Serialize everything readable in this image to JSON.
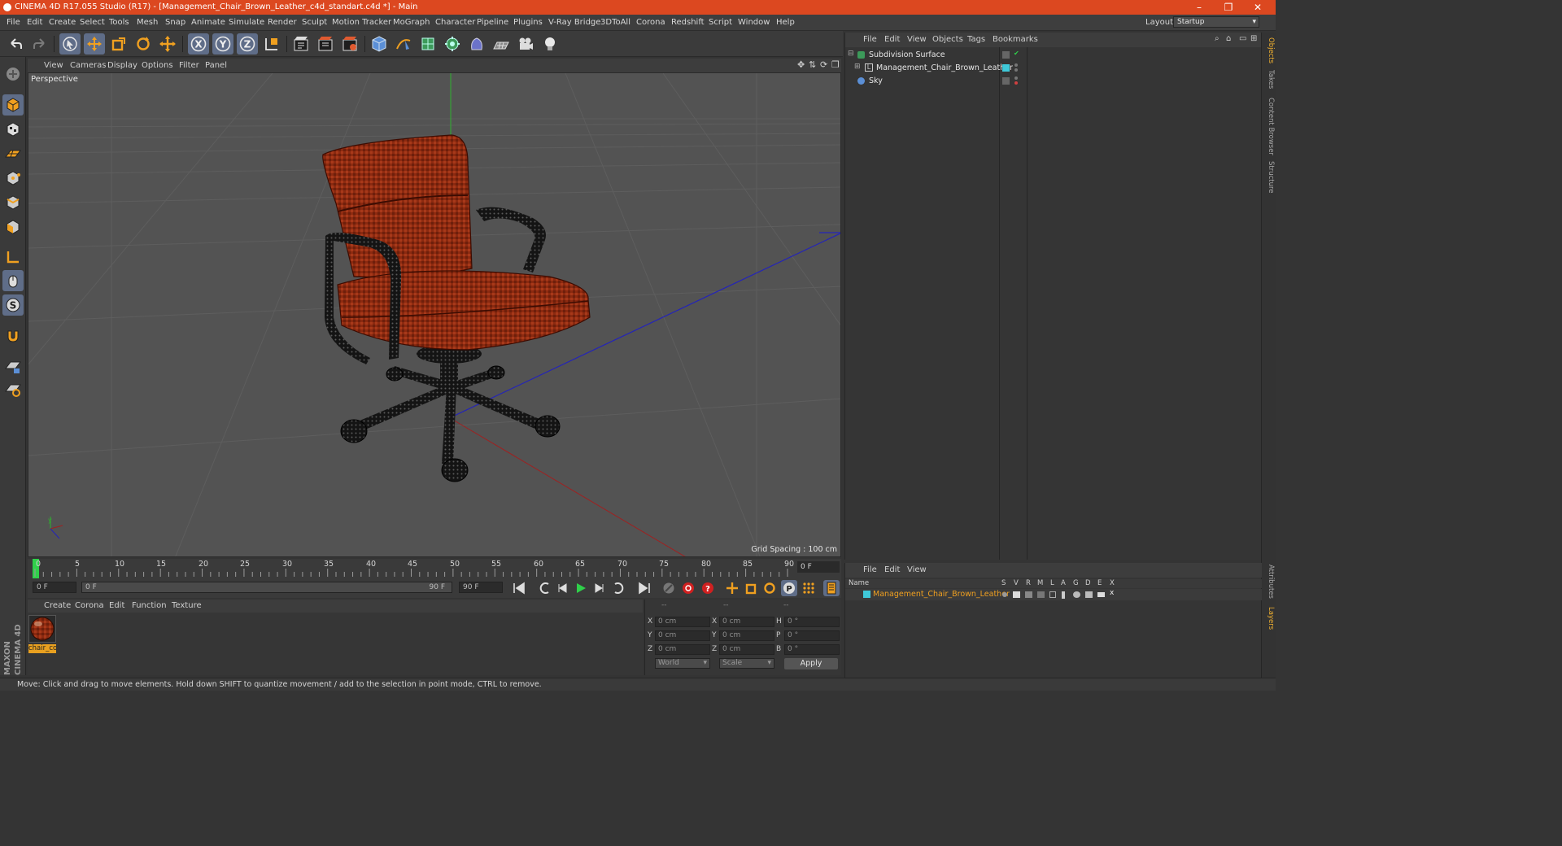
{
  "window": {
    "title": "CINEMA 4D R17.055 Studio (R17) - [Management_Chair_Brown_Leather_c4d_standart.c4d *] - Main",
    "controls": [
      "–",
      "❐",
      "✕"
    ]
  },
  "menubar": {
    "items": [
      "File",
      "Edit",
      "Create",
      "Select",
      "Tools",
      "Mesh",
      "Snap",
      "Animate",
      "Simulate",
      "Render",
      "Sculpt",
      "Motion Tracker",
      "MoGraph",
      "Character",
      "Pipeline",
      "Plugins",
      "V-Ray Bridge",
      "3DToAll",
      "Corona",
      "Redshift",
      "Script",
      "Window",
      "Help"
    ],
    "layout_label": "Layout:",
    "layout_value": "Startup"
  },
  "toolbar": {
    "icons": [
      "undo-icon",
      "redo-icon",
      "select-arrow-icon",
      "move-icon",
      "scale-icon",
      "rotate-icon",
      "live-move-icon",
      "x-axis-icon",
      "y-axis-icon",
      "z-axis-icon",
      "world-coord-icon",
      "render-view-icon",
      "render-picture-queue-icon",
      "render-settings-icon",
      "cube-icon",
      "pen-spline-icon",
      "subdivision-icon",
      "mograph-cloner-icon",
      "deformer-icon",
      "floor-icon",
      "camera-icon",
      "light-icon"
    ],
    "axis_labels": [
      "X",
      "Y",
      "Z"
    ]
  },
  "viewport": {
    "menu": [
      "View",
      "Cameras",
      "Display",
      "Options",
      "Filter",
      "Panel"
    ],
    "camera": "Perspective",
    "grid_spacing": "Grid Spacing : 100 cm"
  },
  "timeline": {
    "ruler_numbers": [
      "0",
      "5",
      "10",
      "15",
      "20",
      "25",
      "30",
      "35",
      "40",
      "45",
      "50",
      "55",
      "60",
      "65",
      "70",
      "75",
      "80",
      "85",
      "90"
    ],
    "current_frame": "0 F",
    "start_field": "0 F",
    "range_start": "0 F",
    "range_end": "90 F",
    "end_field": "90 F"
  },
  "material_manager": {
    "menu": [
      "Create",
      "Corona",
      "Edit",
      "Function",
      "Texture"
    ],
    "material_name": "chair_co"
  },
  "coordinates": {
    "headers": [
      "--",
      "--",
      "--"
    ],
    "rows": [
      {
        "axis": "X",
        "pos": "0 cm",
        "axis2": "X",
        "size": "0 cm",
        "rot_label": "H",
        "rot": "0 °"
      },
      {
        "axis": "Y",
        "pos": "0 cm",
        "axis2": "Y",
        "size": "0 cm",
        "rot_label": "P",
        "rot": "0 °"
      },
      {
        "axis": "Z",
        "pos": "0 cm",
        "axis2": "Z",
        "size": "0 cm",
        "rot_label": "B",
        "rot": "0 °"
      }
    ],
    "mode": "World",
    "transform": "Scale",
    "apply": "Apply"
  },
  "object_manager": {
    "menu": [
      "File",
      "Edit",
      "View",
      "Objects",
      "Tags",
      "Bookmarks"
    ],
    "objects": [
      {
        "name": "Subdivision Surface",
        "icon": "subdivision-icon"
      },
      {
        "name": "Management_Chair_Brown_Leather",
        "icon": "null-object-icon"
      },
      {
        "name": "Sky",
        "icon": "sky-icon"
      }
    ]
  },
  "right_tabs": [
    "Objects",
    "Takes",
    "Content Browser",
    "Structure",
    "Attributes",
    "Layers"
  ],
  "layer_manager": {
    "menu": [
      "File",
      "Edit",
      "View"
    ],
    "columns": [
      "Name",
      "S",
      "V",
      "R",
      "M",
      "L",
      "A",
      "G",
      "D",
      "E",
      "X"
    ],
    "layer_name": "Management_Chair_Brown_Leather",
    "layer_color": "#3fc8d8"
  },
  "status": {
    "text": "Move: Click and drag to move elements. Hold down SHIFT to quantize movement / add to the selection in point mode, CTRL to remove."
  },
  "colors": {
    "titlebar": "#dc4820",
    "accent_active": "#5f6d88",
    "highlight_orange": "#f0a020",
    "chair_leather": "#8c2a10"
  }
}
